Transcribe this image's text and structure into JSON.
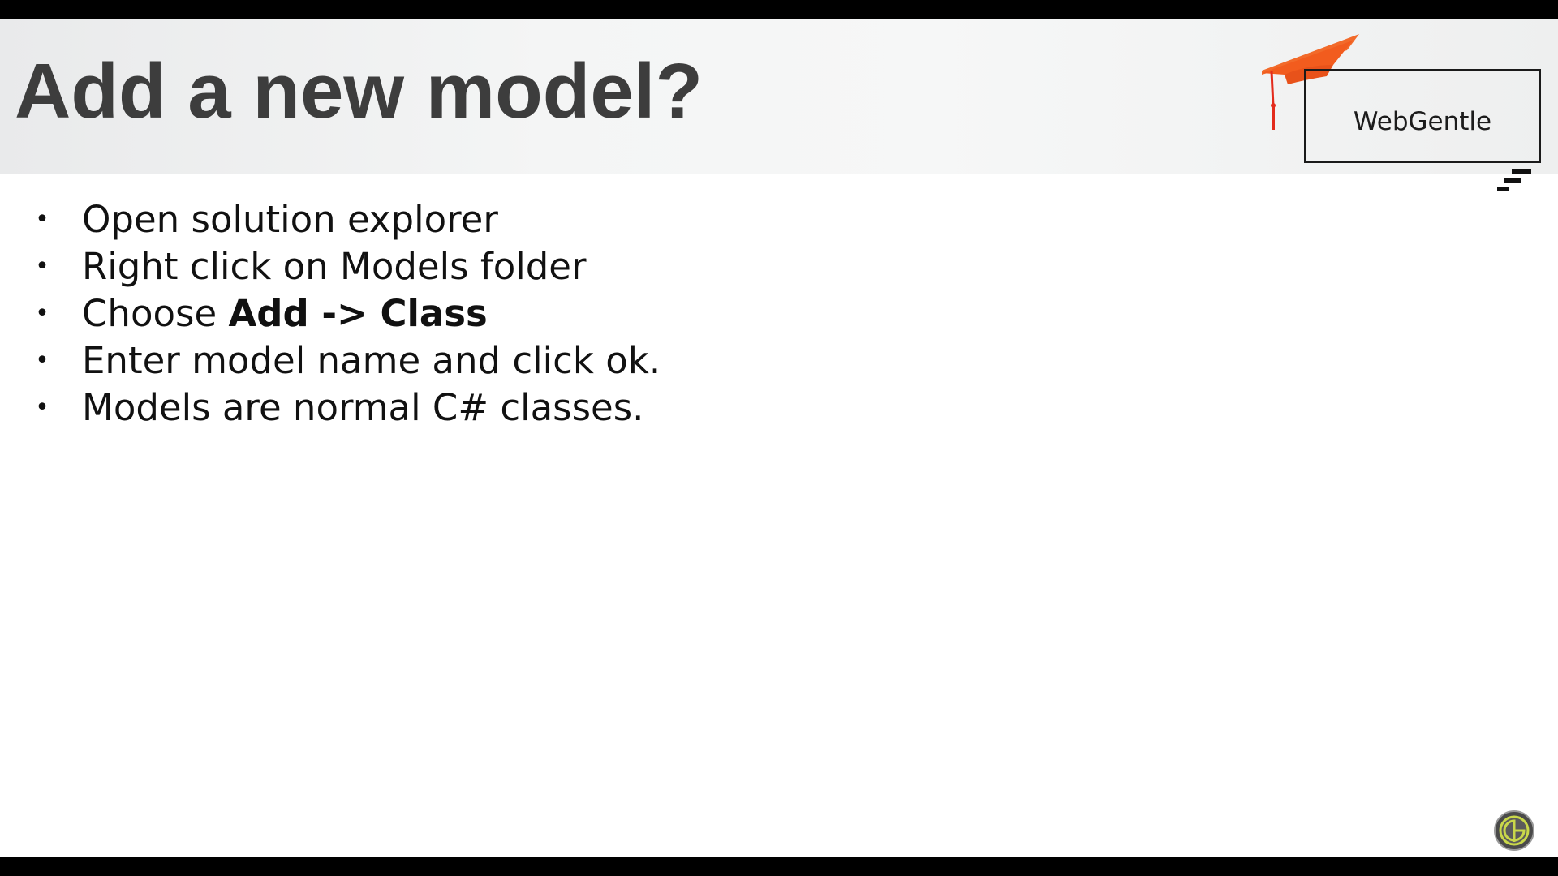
{
  "slide": {
    "title": "Add a new model?",
    "brand": {
      "name": "WebGentle",
      "cap_color": "#f25c1e",
      "tassel_color": "#e32b1c"
    },
    "bullets": [
      {
        "text": "Open solution explorer"
      },
      {
        "text": "Right click on Models folder"
      },
      {
        "prefix": "Choose ",
        "bold_1": "Add",
        "middle": " -> ",
        "bold_2": "Class"
      },
      {
        "text": "Enter model name and click ok."
      },
      {
        "text": "Models are normal C# classes."
      }
    ],
    "bullet_glyph": "•"
  },
  "icons": {
    "logo": "graduation-cap-icon",
    "corner": "circular-logo-icon"
  },
  "colors": {
    "title": "#3d3d3d",
    "body_text": "#111111",
    "frame": "#000000",
    "header_bg": "#f2f3f3"
  }
}
